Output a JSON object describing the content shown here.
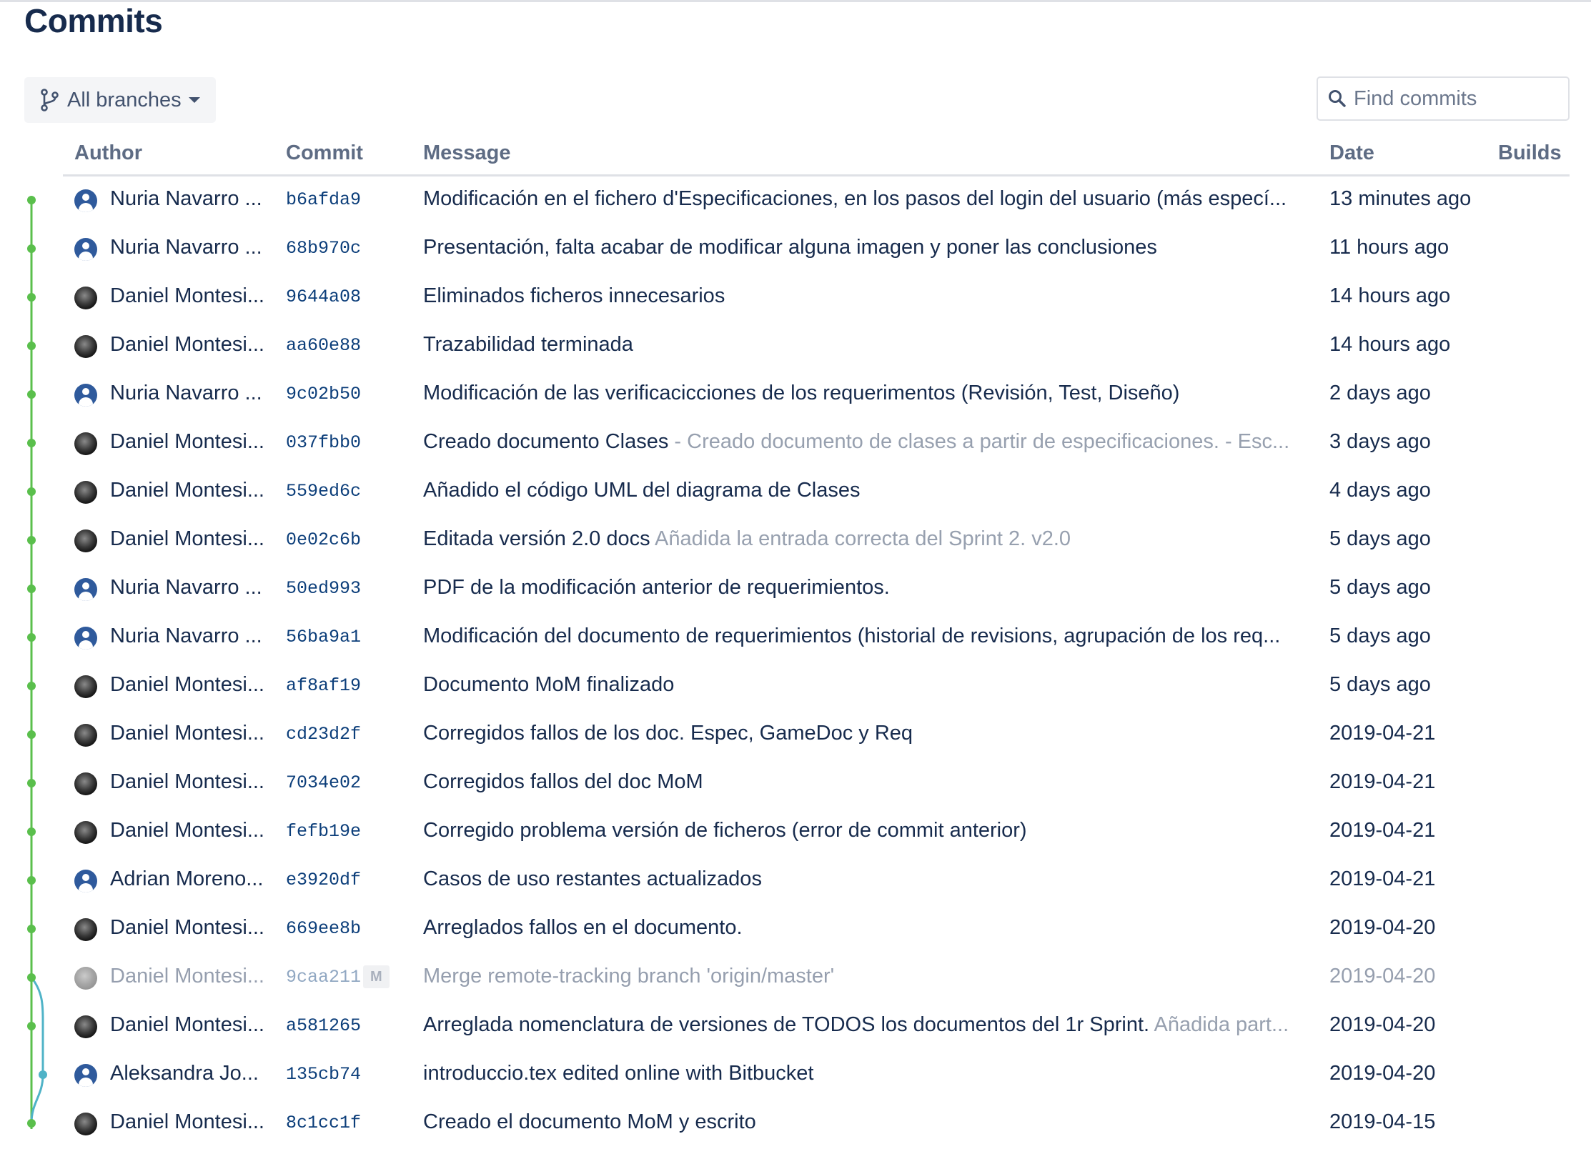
{
  "page": {
    "title": "Commits"
  },
  "toolbar": {
    "branch_filter": "All branches",
    "search_placeholder": "Find commits"
  },
  "columns": {
    "author": "Author",
    "commit": "Commit",
    "message": "Message",
    "date": "Date",
    "builds": "Builds"
  },
  "colors": {
    "graph_main": "#5abf4c",
    "graph_branch": "#4fb3c7",
    "link": "#0c3e7a",
    "muted": "#97a0af"
  },
  "commits": [
    {
      "author": "Nuria Navarro ...",
      "avatar": "default-user-icon",
      "hash": "b6afda9",
      "message": "Modificación en el fichero d'Especificaciones, en los pasos del login del usuario (más especí...",
      "detail": "",
      "date": "13 minutes ago",
      "merge": false
    },
    {
      "author": "Nuria Navarro ...",
      "avatar": "default-user-icon",
      "hash": "68b970c",
      "message": "Presentación, falta acabar de modificar alguna imagen y poner las conclusiones",
      "detail": "",
      "date": "11 hours ago",
      "merge": false
    },
    {
      "author": "Daniel Montesi...",
      "avatar": "photo-avatar",
      "hash": "9644a08",
      "message": "Eliminados ficheros innecesarios",
      "detail": "",
      "date": "14 hours ago",
      "merge": false
    },
    {
      "author": "Daniel Montesi...",
      "avatar": "photo-avatar",
      "hash": "aa60e88",
      "message": "Trazabilidad terminada",
      "detail": "",
      "date": "14 hours ago",
      "merge": false
    },
    {
      "author": "Nuria Navarro ...",
      "avatar": "default-user-icon",
      "hash": "9c02b50",
      "message": "Modificación de las verificacicciones de los requerimentos (Revisión, Test, Diseño)",
      "detail": "",
      "date": "2 days ago",
      "merge": false
    },
    {
      "author": "Daniel Montesi...",
      "avatar": "photo-avatar",
      "hash": "037fbb0",
      "message": "Creado documento Clases",
      "detail": " - Creado documento de clases a partir de especificaciones. - Esc...",
      "date": "3 days ago",
      "merge": false
    },
    {
      "author": "Daniel Montesi...",
      "avatar": "photo-avatar",
      "hash": "559ed6c",
      "message": "Añadido el código UML del diagrama de Clases",
      "detail": "",
      "date": "4 days ago",
      "merge": false
    },
    {
      "author": "Daniel Montesi...",
      "avatar": "photo-avatar",
      "hash": "0e02c6b",
      "message": "Editada versión 2.0 docs",
      "detail": " Añadida la entrada correcta del Sprint 2. v2.0",
      "date": "5 days ago",
      "merge": false
    },
    {
      "author": "Nuria Navarro ...",
      "avatar": "default-user-icon",
      "hash": "50ed993",
      "message": "PDF de la modificación anterior de requerimientos.",
      "detail": "",
      "date": "5 days ago",
      "merge": false
    },
    {
      "author": "Nuria Navarro ...",
      "avatar": "default-user-icon",
      "hash": "56ba9a1",
      "message": "Modificación del documento de requerimientos (historial de revisions, agrupación de los req...",
      "detail": "",
      "date": "5 days ago",
      "merge": false
    },
    {
      "author": "Daniel Montesi...",
      "avatar": "photo-avatar",
      "hash": "af8af19",
      "message": "Documento MoM finalizado",
      "detail": "",
      "date": "5 days ago",
      "merge": false
    },
    {
      "author": "Daniel Montesi...",
      "avatar": "photo-avatar",
      "hash": "cd23d2f",
      "message": "Corregidos fallos de los doc. Espec, GameDoc y Req",
      "detail": "",
      "date": "2019-04-21",
      "merge": false
    },
    {
      "author": "Daniel Montesi...",
      "avatar": "photo-avatar",
      "hash": "7034e02",
      "message": "Corregidos fallos del doc MoM",
      "detail": "",
      "date": "2019-04-21",
      "merge": false
    },
    {
      "author": "Daniel Montesi...",
      "avatar": "photo-avatar",
      "hash": "fefb19e",
      "message": "Corregido problema versión de ficheros (error de commit anterior)",
      "detail": "",
      "date": "2019-04-21",
      "merge": false
    },
    {
      "author": "Adrian Moreno...",
      "avatar": "default-user-icon",
      "hash": "e3920df",
      "message": "Casos de uso restantes actualizados",
      "detail": "",
      "date": "2019-04-21",
      "merge": false
    },
    {
      "author": "Daniel Montesi...",
      "avatar": "photo-avatar",
      "hash": "669ee8b",
      "message": "Arreglados fallos en el documento.",
      "detail": "",
      "date": "2019-04-20",
      "merge": false
    },
    {
      "author": "Daniel Montesi...",
      "avatar": "photo-avatar",
      "hash": "9caa211",
      "message": "Merge remote-tracking branch 'origin/master'",
      "detail": "",
      "date": "2019-04-20",
      "merge": true,
      "badge": "M"
    },
    {
      "author": "Daniel Montesi...",
      "avatar": "photo-avatar",
      "hash": "a581265",
      "message": "Arreglada nomenclatura de versiones de TODOS los documentos del 1r Sprint.",
      "detail": " Añadida part...",
      "date": "2019-04-20",
      "merge": false
    },
    {
      "author": "Aleksandra Jo...",
      "avatar": "default-user-icon",
      "hash": "135cb74",
      "message": "introduccio.tex edited online with Bitbucket",
      "detail": "",
      "date": "2019-04-20",
      "merge": false
    },
    {
      "author": "Daniel Montesi...",
      "avatar": "photo-avatar",
      "hash": "8c1cc1f",
      "message": "Creado el documento MoM y escrito",
      "detail": "",
      "date": "2019-04-15",
      "merge": false
    }
  ]
}
